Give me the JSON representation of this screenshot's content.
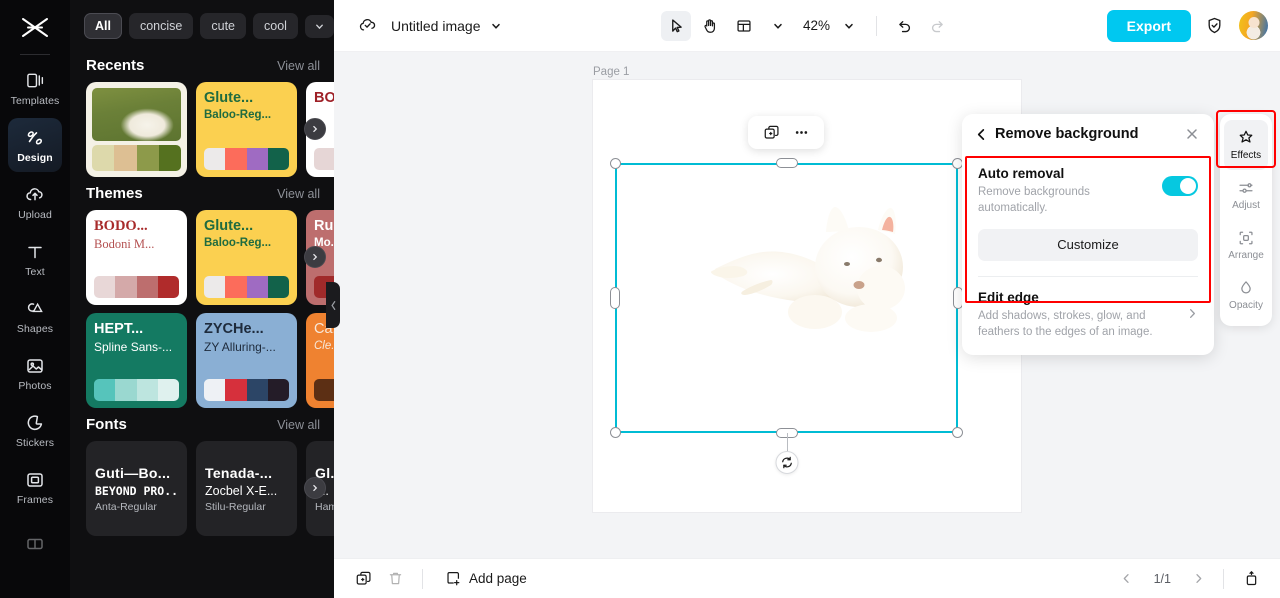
{
  "rail": {
    "logo_icon": "capcut-logo-icon",
    "items": [
      {
        "label": "Templates",
        "icon": "templates-icon",
        "active": false
      },
      {
        "label": "Design",
        "icon": "design-icon",
        "active": true
      },
      {
        "label": "Upload",
        "icon": "upload-cloud-icon",
        "active": false
      },
      {
        "label": "Text",
        "icon": "text-icon",
        "active": false
      },
      {
        "label": "Shapes",
        "icon": "shapes-icon",
        "active": false
      },
      {
        "label": "Photos",
        "icon": "photos-icon",
        "active": false
      },
      {
        "label": "Stickers",
        "icon": "stickers-icon",
        "active": false
      },
      {
        "label": "Frames",
        "icon": "frames-icon",
        "active": false
      }
    ]
  },
  "panel": {
    "chips": [
      {
        "label": "All",
        "selected": true
      },
      {
        "label": "concise",
        "selected": false
      },
      {
        "label": "cute",
        "selected": false
      },
      {
        "label": "cool",
        "selected": false
      }
    ],
    "chip_more_icon": "chevron-down-icon",
    "sections": [
      {
        "title": "Recents",
        "view_all": "View all"
      },
      {
        "title": "Themes",
        "view_all": "View all"
      },
      {
        "title": "Fonts",
        "view_all": "View all"
      }
    ],
    "recents": [
      {
        "type": "photo",
        "swatches": [
          "#ddd9ab",
          "#ddbf93",
          "#8d9a4a",
          "#55711f"
        ],
        "bg": "#f4f1e6"
      },
      {
        "type": "theme",
        "title": "Glute...",
        "sub": "Baloo-Reg...",
        "bg": "#fbd050",
        "title_color": "#1f6b3f",
        "sub_color": "#1f6b3f",
        "swatches": [
          "#eceaea",
          "#fc6c5b",
          "#9f6bc2",
          "#12624a"
        ]
      },
      {
        "type": "theme",
        "title": "BO...",
        "sub": "",
        "bg": "#ffffff",
        "title_color": "#9e2027",
        "sub_color": "#9e2027",
        "swatches": [
          "#e6d6d6",
          "#d9b9b9",
          "#b96b6b",
          "#a32a2a"
        ]
      }
    ],
    "themes": [
      {
        "title": "BODO...",
        "sub": "Bodoni M...",
        "bg": "#ffffff",
        "title_color": "#a82b2b",
        "sub_color": "#b45151",
        "swatches": [
          "#e8d7d7",
          "#d4a9a9",
          "#bd6e6e",
          "#b02b2b"
        ]
      },
      {
        "title": "Glute...",
        "sub": "Baloo-Reg...",
        "bg": "#fbd050",
        "title_color": "#1f6b3f",
        "sub_color": "#1f6b3f",
        "swatches": [
          "#eceaea",
          "#fc6c5b",
          "#9f6bc2",
          "#12624a"
        ]
      },
      {
        "title": "Ru...",
        "sub": "Mo...",
        "bg": "#bd6e6e",
        "title_color": "#ffffff",
        "sub_color": "#ffffff",
        "swatches": [
          "#a02a2a",
          "#a02a2a",
          "#a02a2a",
          "#a02a2a"
        ]
      },
      {
        "title": "HEPT...",
        "sub": "Spline Sans-...",
        "bg": "#147a62",
        "title_color": "#ffffff",
        "sub_color": "#ffffff",
        "swatches": [
          "#56c4bb",
          "#9ad8d0",
          "#bde5df",
          "#dff1ee"
        ]
      },
      {
        "title": "ZYCHe...",
        "sub": "ZY Alluring-...",
        "bg": "#8aafd4",
        "title_color": "#1e2b3c",
        "sub_color": "#1e2b3c",
        "swatches": [
          "#eef1f5",
          "#d6303c",
          "#2c4566",
          "#241c28"
        ]
      },
      {
        "title": "Ca...",
        "sub": "Cle...",
        "bg": "#ef8230",
        "title_color": "#f7e7d8",
        "sub_color": "#f7e7d8",
        "swatches": [
          "#5c2f14",
          "#5c2f14",
          "#5c2f14",
          "#5c2f14"
        ]
      }
    ],
    "fonts": [
      {
        "line1": "Guti—Bo...",
        "line2": "BEYOND PRO...",
        "line3": "Anta-Regular"
      },
      {
        "line1": "Tenada-...",
        "line2": "Zocbel X-E...",
        "line3": "Stilu-Regular"
      },
      {
        "line1": "Gl...",
        "line2": "[...",
        "line3": "Ham..."
      }
    ],
    "carousel_next_icon": "chevron-right-icon",
    "collapse_icon": "chevron-left-icon"
  },
  "topbar": {
    "cloud_icon": "cloud-saved-icon",
    "doc_name": "Untitled image",
    "doc_caret_icon": "chevron-down-icon",
    "select_tool_icon": "cursor-arrow-icon",
    "hand_tool_icon": "hand-icon",
    "layout_tool_icon": "layout-grid-icon",
    "layout_caret_icon": "chevron-down-icon",
    "zoom_value": "42%",
    "zoom_caret_icon": "chevron-down-icon",
    "undo_icon": "undo-icon",
    "redo_icon": "redo-icon",
    "export_label": "Export",
    "shield_icon": "shield-icon",
    "avatar_icon": "user-avatar"
  },
  "canvas": {
    "page_label": "Page 1",
    "float_toolbar": {
      "duplicate_icon": "duplicate-layer-icon",
      "more_icon": "more-options-icon"
    },
    "rotate_icon": "rotate-handle-icon",
    "selection_color": "#00bcd4"
  },
  "right_panel": {
    "back_icon": "chevron-left-icon",
    "title": "Remove background",
    "close_icon": "close-icon",
    "auto_removal": {
      "title": "Auto removal",
      "description": "Remove backgrounds automatically.",
      "toggle_on": true,
      "customize_label": "Customize"
    },
    "edit_edge": {
      "title": "Edit edge",
      "description": "Add shadows, strokes, glow, and feathers to the edges of an image.",
      "chevron_icon": "chevron-right-icon"
    },
    "highlight_color": "#ff0000"
  },
  "right_rail": {
    "items": [
      {
        "label": "Effects",
        "icon": "effects-icon",
        "active": true
      },
      {
        "label": "Adjust",
        "icon": "adjust-sliders-icon",
        "active": false
      },
      {
        "label": "Arrange",
        "icon": "arrange-icon",
        "active": false
      },
      {
        "label": "Opacity",
        "icon": "opacity-drop-icon",
        "active": false
      }
    ]
  },
  "bottombar": {
    "duplicate_icon": "duplicate-page-icon",
    "delete_icon": "trash-icon",
    "add_page_icon": "add-page-icon",
    "add_page_label": "Add page",
    "prev_icon": "chevron-left-icon",
    "next_icon": "chevron-right-icon",
    "page_indicator": "1/1",
    "export_page_icon": "export-page-icon"
  }
}
